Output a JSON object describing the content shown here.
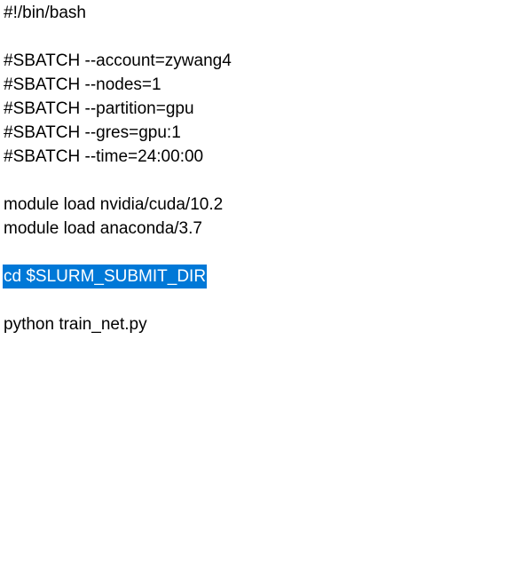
{
  "editor": {
    "lines": [
      "#!/bin/bash",
      "#SBATCH --account=zywang4",
      "#SBATCH --nodes=1",
      "#SBATCH --partition=gpu",
      "#SBATCH --gres=gpu:1",
      "#SBATCH --time=24:00:00",
      "module load nvidia/cuda/10.2",
      "module load anaconda/3.7",
      "cd $SLURM_SUBMIT_DIR",
      "python train_net.py"
    ],
    "selection_color": "#0078d7"
  }
}
